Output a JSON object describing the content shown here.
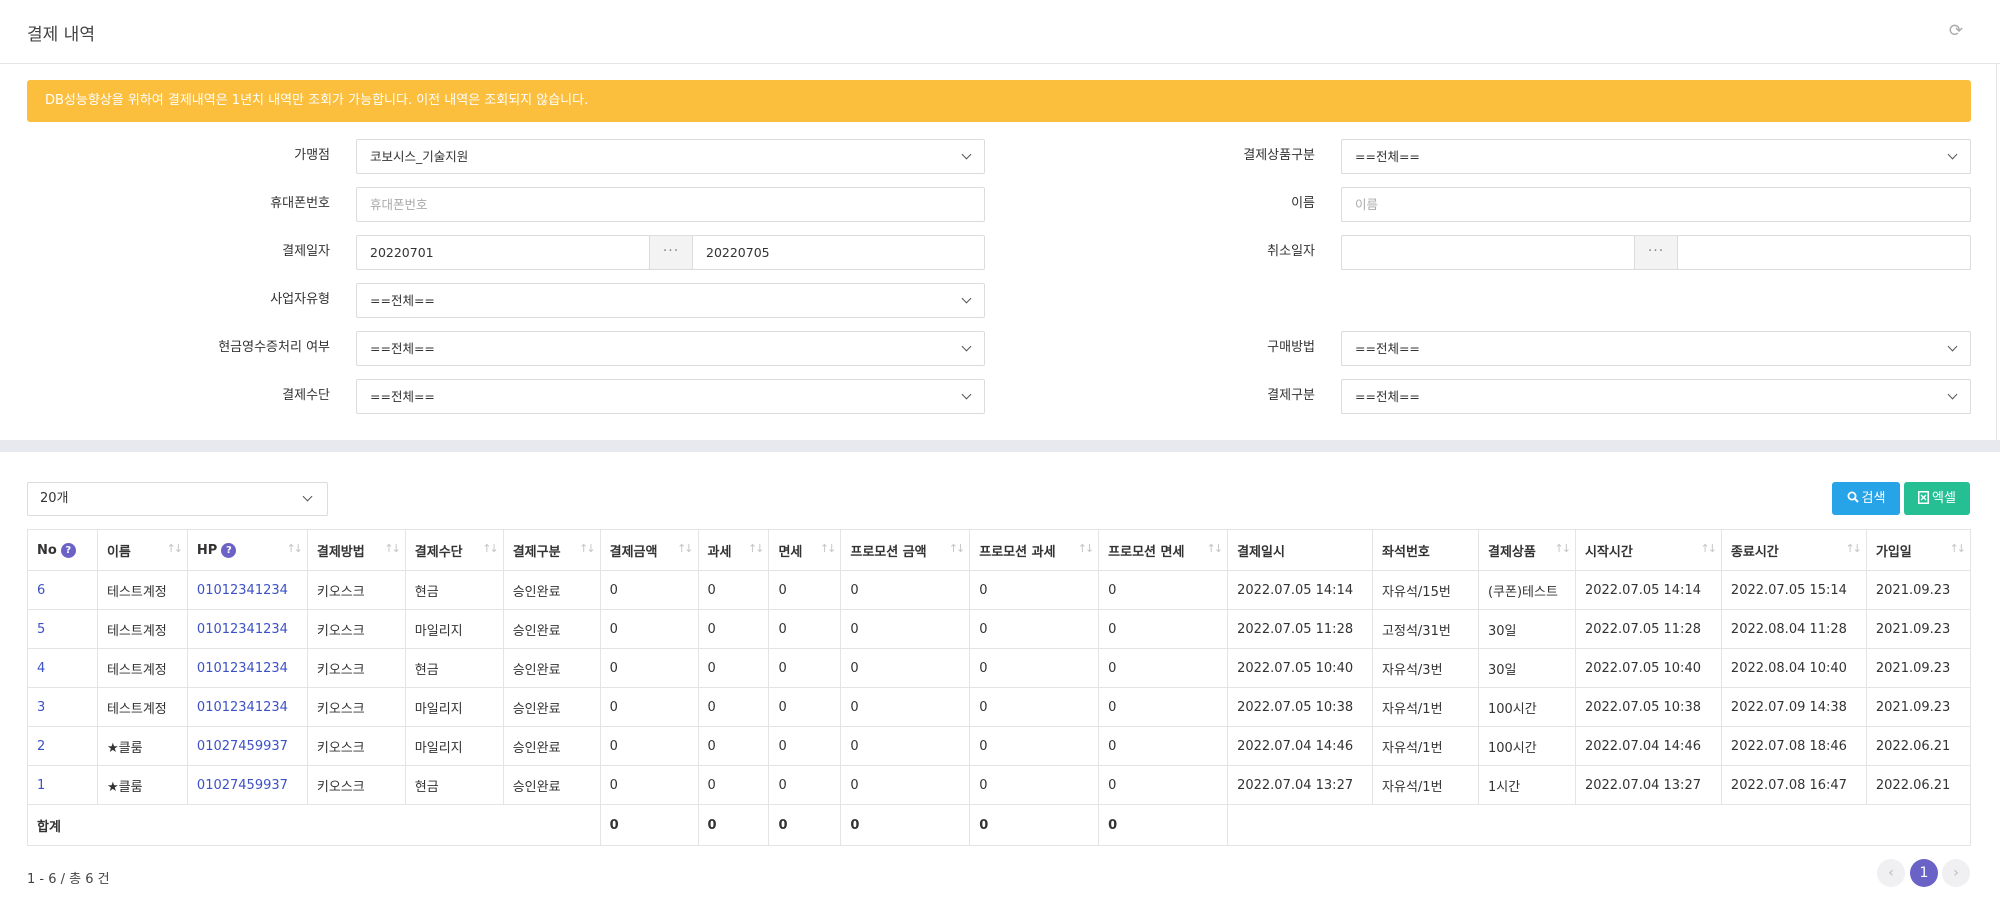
{
  "page": {
    "title": "결제 내역"
  },
  "alert": {
    "text": "DB성능향상을 위하여 결제내역은 1년치 내역만 조회가 가능합니다. 이전 내역은 조회되지 않습니다."
  },
  "form": {
    "store": {
      "label": "가맹점",
      "value": "코보시스_기술지원"
    },
    "product_type": {
      "label": "결제상품구분",
      "value": "==전체=="
    },
    "phone": {
      "label": "휴대폰번호",
      "placeholder": "휴대폰번호"
    },
    "name": {
      "label": "이름",
      "placeholder": "이름"
    },
    "pay_date": {
      "label": "결제일자",
      "from": "20220701",
      "to": "20220705",
      "picker": "···"
    },
    "cancel_date": {
      "label": "취소일자",
      "from": "",
      "to": "",
      "picker": "···"
    },
    "business_type": {
      "label": "사업자유형",
      "value": "==전체=="
    },
    "cash_receipt": {
      "label": "현금영수증처리 여부",
      "value": "==전체=="
    },
    "purchase_method": {
      "label": "구매방법",
      "value": "==전체=="
    },
    "payment_means": {
      "label": "결제수단",
      "value": "==전체=="
    },
    "payment_kind": {
      "label": "결제구분",
      "value": "==전체=="
    }
  },
  "toolbar": {
    "page_size": "20개",
    "search_label": "검색",
    "excel_label": "엑셀"
  },
  "table": {
    "columns": [
      "No",
      "이름",
      "HP",
      "결제방법",
      "결제수단",
      "결제구분",
      "결제금액",
      "과세",
      "면세",
      "프로모션 금액",
      "프로모션 과세",
      "프로모션 면세",
      "결제일시",
      "좌석번호",
      "결제상품",
      "시작시간",
      "종료시간",
      "가입일"
    ],
    "rows": [
      [
        "6",
        "테스트계정",
        "01012341234",
        "키오스크",
        "현금",
        "승인완료",
        "0",
        "0",
        "0",
        "0",
        "0",
        "0",
        "2022.07.05 14:14",
        "자유석/15번",
        "(쿠폰)테스트",
        "2022.07.05 14:14",
        "2022.07.05 15:14",
        "2021.09.23"
      ],
      [
        "5",
        "테스트계정",
        "01012341234",
        "키오스크",
        "마일리지",
        "승인완료",
        "0",
        "0",
        "0",
        "0",
        "0",
        "0",
        "2022.07.05 11:28",
        "고정석/31번",
        "30일",
        "2022.07.05 11:28",
        "2022.08.04 11:28",
        "2021.09.23"
      ],
      [
        "4",
        "테스트계정",
        "01012341234",
        "키오스크",
        "현금",
        "승인완료",
        "0",
        "0",
        "0",
        "0",
        "0",
        "0",
        "2022.07.05 10:40",
        "자유석/3번",
        "30일",
        "2022.07.05 10:40",
        "2022.08.04 10:40",
        "2021.09.23"
      ],
      [
        "3",
        "테스트계정",
        "01012341234",
        "키오스크",
        "마일리지",
        "승인완료",
        "0",
        "0",
        "0",
        "0",
        "0",
        "0",
        "2022.07.05 10:38",
        "자유석/1번",
        "100시간",
        "2022.07.05 10:38",
        "2022.07.09 14:38",
        "2021.09.23"
      ],
      [
        "2",
        "★클룸",
        "01027459937",
        "키오스크",
        "마일리지",
        "승인완료",
        "0",
        "0",
        "0",
        "0",
        "0",
        "0",
        "2022.07.04 14:46",
        "자유석/1번",
        "100시간",
        "2022.07.04 14:46",
        "2022.07.08 18:46",
        "2022.06.21"
      ],
      [
        "1",
        "★클룸",
        "01027459937",
        "키오스크",
        "현금",
        "승인완료",
        "0",
        "0",
        "0",
        "0",
        "0",
        "0",
        "2022.07.04 13:27",
        "자유석/1번",
        "1시간",
        "2022.07.04 13:27",
        "2022.07.08 16:47",
        "2022.06.21"
      ]
    ],
    "total": {
      "label": "합계",
      "values": [
        "0",
        "0",
        "0",
        "0",
        "0",
        "0"
      ]
    }
  },
  "pagination": {
    "summary": "1 - 6 / 총 6 건",
    "current": "1",
    "prev": "‹",
    "next": "›"
  },
  "icons": {
    "refresh": "refresh-icon",
    "search": "search-icon",
    "excel": "excel-icon",
    "help": "question-icon",
    "sort": "sort-icon",
    "dropdown": "chevron-down-icon"
  },
  "colors": {
    "alert": "#fbbe3d",
    "search_button": "#27a3e8",
    "excel_button": "#26bf94",
    "link": "#3d51c7",
    "accent": "#6b62c7"
  }
}
